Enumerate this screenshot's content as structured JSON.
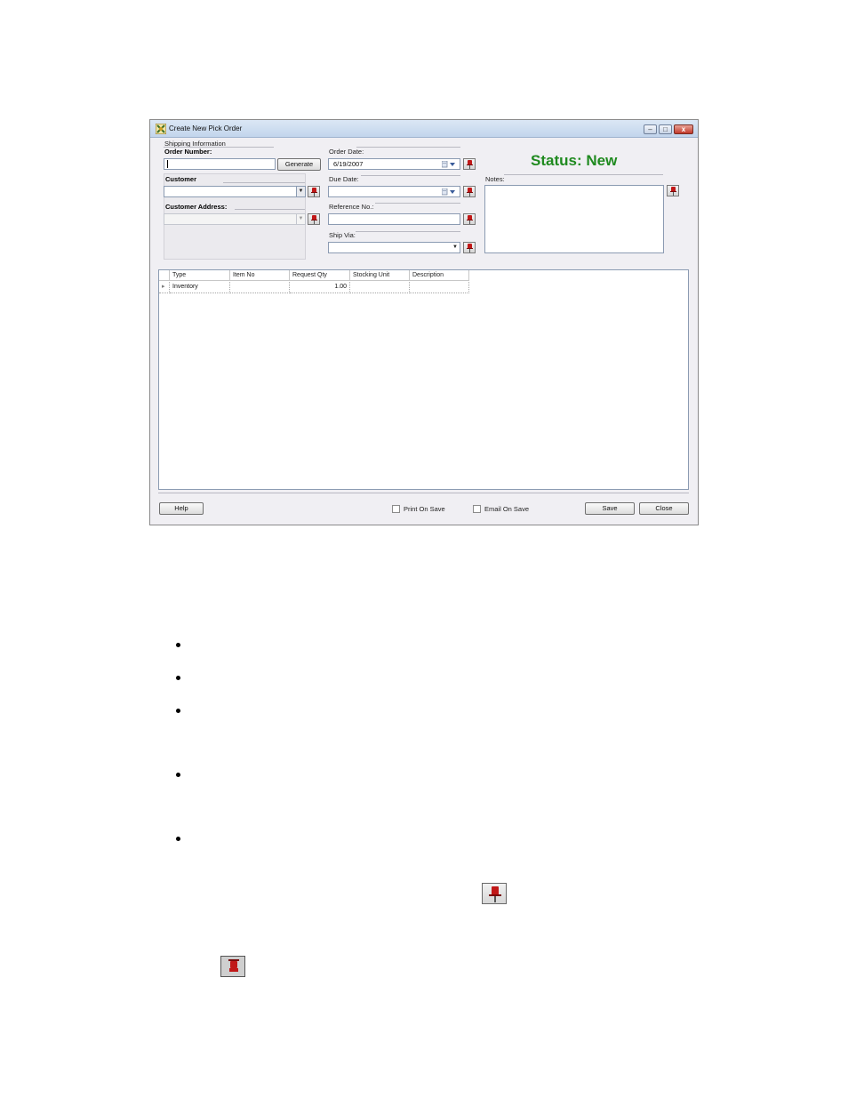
{
  "window": {
    "title": "Create New Pick Order",
    "minimize_glyph": "–",
    "maximize_glyph": "□",
    "close_glyph": "x",
    "icon": "pick-order-app-icon"
  },
  "form": {
    "shipping_info_label": "Shipping Information",
    "order_number_label": "Order Number:",
    "order_number_value": "",
    "generate_label": "Generate",
    "customer_label": "Customer",
    "customer_value": "",
    "customer_address_label": "Customer Address:",
    "customer_address_value": "",
    "order_date_label": "Order Date:",
    "order_date_value": "6/19/2007",
    "due_date_label": "Due Date:",
    "due_date_value": "",
    "reference_label": "Reference No.:",
    "reference_value": "",
    "ship_via_label": "Ship Via:",
    "ship_via_value": "",
    "notes_label": "Notes:",
    "notes_value": "",
    "status_text": "Status: New",
    "status_color": "#1f8a1f"
  },
  "grid": {
    "columns": [
      "Type",
      "Item No",
      "Request Qty",
      "Stocking Unit",
      "Description"
    ],
    "rows": [
      {
        "type": "Inventory",
        "item_no": "",
        "request_qty": "1.00",
        "stocking_unit": "",
        "description": ""
      }
    ],
    "row_indicator": "▸"
  },
  "footer": {
    "help_label": "Help",
    "print_on_save_label": "Print On Save",
    "print_on_save_checked": false,
    "email_on_save_label": "Email On Save",
    "email_on_save_checked": false,
    "save_label": "Save",
    "close_label": "Close"
  },
  "icons": {
    "pin": "pushpin-icon",
    "calendar": "calendar-icon",
    "dropdown": "chevron-down-icon",
    "dropdown_glyph": "▼"
  },
  "colors": {
    "pin_red": "#c11818",
    "window_bg": "#f0eff3"
  }
}
